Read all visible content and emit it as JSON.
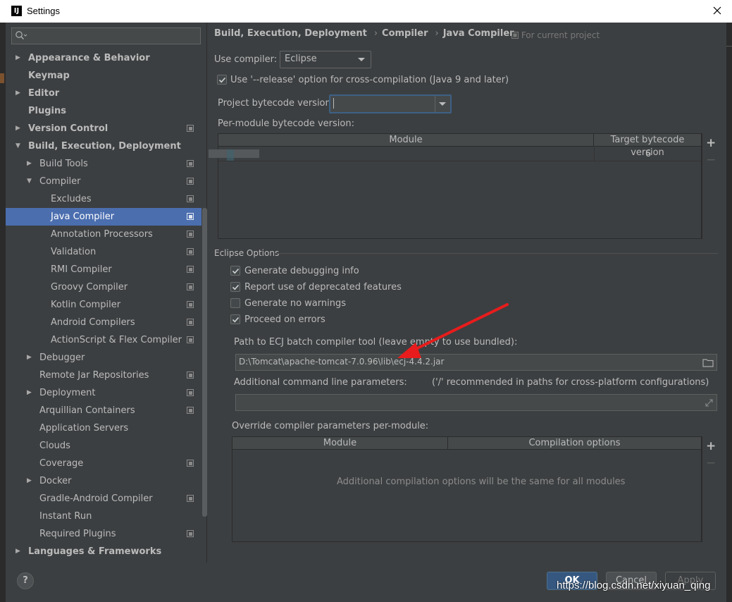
{
  "window": {
    "title": "Settings",
    "app_icon_text": "IJ"
  },
  "colors": {
    "background": "#3c3f41",
    "selection": "#4b6eaf",
    "ok_button": "#365880",
    "annotation_arrow": "#e81c1c"
  },
  "search": {
    "placeholder": ""
  },
  "tree": [
    {
      "label": "Appearance & Behavior",
      "level": 0,
      "arrow": "right",
      "bold": true,
      "project": false
    },
    {
      "label": "Keymap",
      "level": 0,
      "arrow": "",
      "bold": true,
      "project": false
    },
    {
      "label": "Editor",
      "level": 0,
      "arrow": "right",
      "bold": true,
      "project": false
    },
    {
      "label": "Plugins",
      "level": 0,
      "arrow": "",
      "bold": true,
      "project": false
    },
    {
      "label": "Version Control",
      "level": 0,
      "arrow": "right",
      "bold": true,
      "project": true
    },
    {
      "label": "Build, Execution, Deployment",
      "level": 0,
      "arrow": "down",
      "bold": true,
      "project": false
    },
    {
      "label": "Build Tools",
      "level": 1,
      "arrow": "right",
      "bold": false,
      "project": true
    },
    {
      "label": "Compiler",
      "level": 1,
      "arrow": "down",
      "bold": false,
      "project": true
    },
    {
      "label": "Excludes",
      "level": 2,
      "arrow": "",
      "bold": false,
      "project": true
    },
    {
      "label": "Java Compiler",
      "level": 2,
      "arrow": "",
      "bold": false,
      "project": true,
      "selected": true
    },
    {
      "label": "Annotation Processors",
      "level": 2,
      "arrow": "",
      "bold": false,
      "project": true
    },
    {
      "label": "Validation",
      "level": 2,
      "arrow": "",
      "bold": false,
      "project": true
    },
    {
      "label": "RMI Compiler",
      "level": 2,
      "arrow": "",
      "bold": false,
      "project": true
    },
    {
      "label": "Groovy Compiler",
      "level": 2,
      "arrow": "",
      "bold": false,
      "project": true
    },
    {
      "label": "Kotlin Compiler",
      "level": 2,
      "arrow": "",
      "bold": false,
      "project": true
    },
    {
      "label": "Android Compilers",
      "level": 2,
      "arrow": "",
      "bold": false,
      "project": true
    },
    {
      "label": "ActionScript & Flex Compiler",
      "level": 2,
      "arrow": "",
      "bold": false,
      "project": true
    },
    {
      "label": "Debugger",
      "level": 1,
      "arrow": "right",
      "bold": false,
      "project": false
    },
    {
      "label": "Remote Jar Repositories",
      "level": 1,
      "arrow": "",
      "bold": false,
      "project": true
    },
    {
      "label": "Deployment",
      "level": 1,
      "arrow": "right",
      "bold": false,
      "project": true
    },
    {
      "label": "Arquillian Containers",
      "level": 1,
      "arrow": "",
      "bold": false,
      "project": true
    },
    {
      "label": "Application Servers",
      "level": 1,
      "arrow": "",
      "bold": false,
      "project": false
    },
    {
      "label": "Clouds",
      "level": 1,
      "arrow": "",
      "bold": false,
      "project": false
    },
    {
      "label": "Coverage",
      "level": 1,
      "arrow": "",
      "bold": false,
      "project": true
    },
    {
      "label": "Docker",
      "level": 1,
      "arrow": "right",
      "bold": false,
      "project": false
    },
    {
      "label": "Gradle-Android Compiler",
      "level": 1,
      "arrow": "",
      "bold": false,
      "project": true
    },
    {
      "label": "Instant Run",
      "level": 1,
      "arrow": "",
      "bold": false,
      "project": false
    },
    {
      "label": "Required Plugins",
      "level": 1,
      "arrow": "",
      "bold": false,
      "project": true
    },
    {
      "label": "Languages & Frameworks",
      "level": 0,
      "arrow": "right",
      "bold": true,
      "project": false
    }
  ],
  "breadcrumb": {
    "items": [
      "Build, Execution, Deployment",
      "Compiler",
      "Java Compiler"
    ],
    "separator": "›",
    "for_project": "For current project"
  },
  "compiler": {
    "use_compiler_label": "Use compiler:",
    "use_compiler_value": "Eclipse",
    "release_option_label": "Use '--release' option for cross-compilation (Java 9 and later)",
    "release_option_checked": true,
    "project_bytecode_label": "Project bytecode version:",
    "project_bytecode_value": "",
    "per_module_label": "Per-module bytecode version:",
    "module_table": {
      "columns": [
        "Module",
        "Target bytecode version"
      ],
      "rows": [
        {
          "module": "",
          "version": "6"
        }
      ]
    }
  },
  "eclipse_options": {
    "title": "Eclipse Options",
    "checkboxes": [
      {
        "label": "Generate debugging info",
        "checked": true
      },
      {
        "label": "Report use of deprecated features",
        "checked": true
      },
      {
        "label": "Generate no warnings",
        "checked": false
      },
      {
        "label": "Proceed on errors",
        "checked": true
      }
    ],
    "ecj_path_label": "Path to ECJ batch compiler tool (leave empty to use bundled):",
    "ecj_path_value": "D:\\Tomcat\\apache-tomcat-7.0.96\\lib\\ecj-4.4.2.jar",
    "additional_params_label": "Additional command line parameters:",
    "additional_params_hint": "('/' recommended in paths for cross-platform configurations)",
    "additional_params_value": "",
    "override_label": "Override compiler parameters per-module:",
    "override_table": {
      "columns": [
        "Module",
        "Compilation options"
      ],
      "empty_text": "Additional compilation options will be the same for all modules"
    }
  },
  "buttons": {
    "help": "?",
    "ok": "OK",
    "cancel": "Cancel",
    "apply": "Apply",
    "plus": "+",
    "minus": "−"
  },
  "watermark": "https://blog.csdn.net/xiyuan_qing"
}
